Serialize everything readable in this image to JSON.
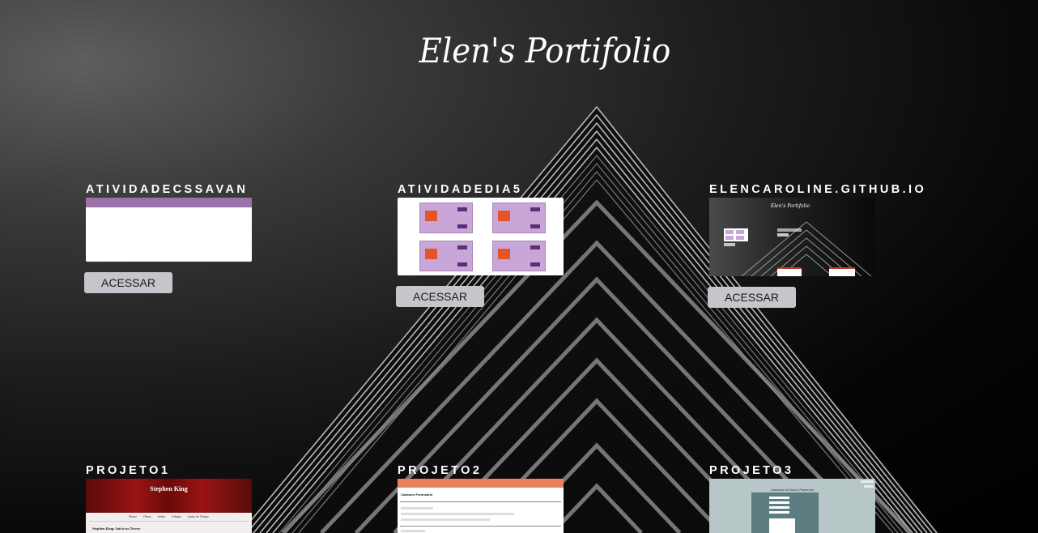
{
  "header": {
    "title": "Elen's Portifolio"
  },
  "projects": [
    {
      "title": "ATIVIDADECSSAVAN",
      "button": "ACESSAR"
    },
    {
      "title": "ATIVIDADEDIA5",
      "button": "ACESSAR"
    },
    {
      "title": "ELENCAROLINE.GITHUB.IO",
      "button": "ACESSAR"
    },
    {
      "title": "PROJETO1"
    },
    {
      "title": "PROJETO2"
    },
    {
      "title": "PROJETO3"
    }
  ],
  "thumbs": {
    "projeto1_heading": "Stephen King",
    "projeto1_caption": "Stephen King: Início no Terror",
    "projeto1_nav": [
      "Home",
      "Obras",
      "Sobre",
      "Adapta",
      "Linha do Tempo"
    ],
    "projeto2_heading": "Cadastro Formulário",
    "projeto3_heading": "Cadastro de Novos Pacientes"
  },
  "colors": {
    "button_bg": "#c8c4cc",
    "thumb1_nav": "#9b72a8",
    "thumb2_cards": "#c9a6d8",
    "thumb5_nav": "#e8805a"
  }
}
